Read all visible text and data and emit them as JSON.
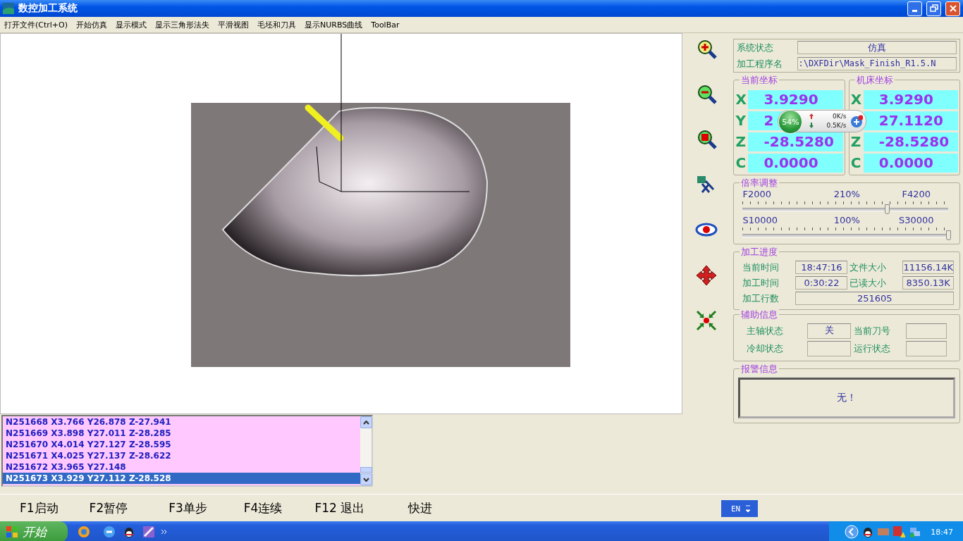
{
  "window": {
    "title": "数控加工系统"
  },
  "menu": [
    "打开文件(Ctrl+O)",
    "开始仿真",
    "显示模式",
    "显示三角形法失",
    "平滑视图",
    "毛坯和刀具",
    "显示NURBS曲线",
    "ToolBar"
  ],
  "status": {
    "state_label": "系统状态",
    "state": "仿真",
    "program_label": "加工程序名",
    "program": ":\\DXFDir\\Mask_Finish_R1.5.N"
  },
  "current_coordinates": {
    "title": "当前坐标",
    "rows": [
      {
        "axis": "X",
        "value": "3.9290"
      },
      {
        "axis": "Y",
        "value": "2"
      },
      {
        "axis": "Z",
        "value": "-28.5280"
      },
      {
        "axis": "C",
        "value": "0.0000"
      }
    ]
  },
  "machine_coordinates": {
    "title": "机床坐标",
    "rows": [
      {
        "axis": "X",
        "value": "3.9290"
      },
      {
        "value": "27.1120"
      },
      {
        "axis": "Z",
        "value": "-28.5280"
      },
      {
        "axis": "C",
        "value": "0.0000"
      }
    ]
  },
  "speed_widget": {
    "percent": "54%",
    "upload": "0K/s",
    "download": "0.5K/s"
  },
  "override": {
    "title": "倍率调整",
    "sliders": [
      {
        "min_label": "F2000",
        "percent": "210%",
        "value_label": "F4200",
        "level": 0.7
      },
      {
        "min_label": "S10000",
        "percent": "100%",
        "value_label": "S30000",
        "level": 1
      }
    ]
  },
  "progress": {
    "title": "加工进度",
    "fields": [
      {
        "label": "当前时间",
        "value": "18:47:16"
      },
      {
        "label": "文件大小",
        "value": "11156.14K"
      },
      {
        "label": "加工时间",
        "value": "0:30:22"
      },
      {
        "label": "已读大小",
        "value": "8350.13K"
      }
    ],
    "lines_label": "加工行数",
    "lines_value": "251605"
  },
  "aux": {
    "title": "辅助信息",
    "fields": [
      {
        "label": "主轴状态",
        "value": "关"
      },
      {
        "label": "当前刀号"
      },
      {
        "label": "冷却状态"
      },
      {
        "label": "运行状态"
      }
    ]
  },
  "alarm": {
    "title": "报警信息",
    "message": "无！"
  },
  "gcode_list": {
    "lines": [
      {
        "text": "N251668 X3.766 Y26.878 Z-27.941",
        "selected": false
      },
      {
        "text": "N251669 X3.898 Y27.011 Z-28.285",
        "selected": false
      },
      {
        "text": "N251670 X4.014 Y27.127 Z-28.595",
        "selected": false
      },
      {
        "text": "N251671 X4.025 Y27.137 Z-28.622",
        "selected": false
      },
      {
        "text": "N251672 X3.965 Y27.148",
        "selected": false
      },
      {
        "text": "N251673 X3.929 Y27.112 Z-28.528",
        "selected": true
      }
    ]
  },
  "function_keys": [
    "F1启动",
    "F2暂停",
    "F3单步",
    "F4连续",
    "F12 退出",
    "快进"
  ],
  "language": "EN",
  "taskbar": {
    "start": "开始",
    "clock": "18:47"
  }
}
